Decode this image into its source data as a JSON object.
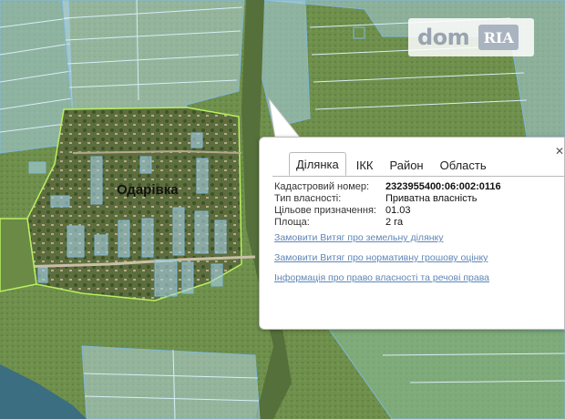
{
  "map": {
    "village_label": "Одарівка",
    "colors": {
      "parcel_fill": "#a9d2e8",
      "parcel_stroke": "#7fb8da",
      "village_boundary": "#b8f060",
      "field_green": "#6f8f4c",
      "river": "#3a6e80"
    },
    "parcel_stroke_weight": "thin"
  },
  "watermark": {
    "brand": "dom",
    "badge": "RIA"
  },
  "popup": {
    "tabs": [
      "Ділянка",
      "ІКК",
      "Район",
      "Область"
    ],
    "active_tab": "Ділянка",
    "fields": [
      {
        "label": "Кадастровий номер:",
        "value": "2323955400:06:002:0116"
      },
      {
        "label": "Тип власності:",
        "value": "Приватна власність"
      },
      {
        "label": "Цільове призначення:",
        "value": "01.03"
      },
      {
        "label": "Площа:",
        "value": "2 га"
      }
    ],
    "links": [
      "Замовити Витяг про земельну ділянку",
      "Замовити Витяг про нормативну грошову оцінку",
      "Інформація про право власності та речові права"
    ],
    "close_icon": "close-icon"
  }
}
